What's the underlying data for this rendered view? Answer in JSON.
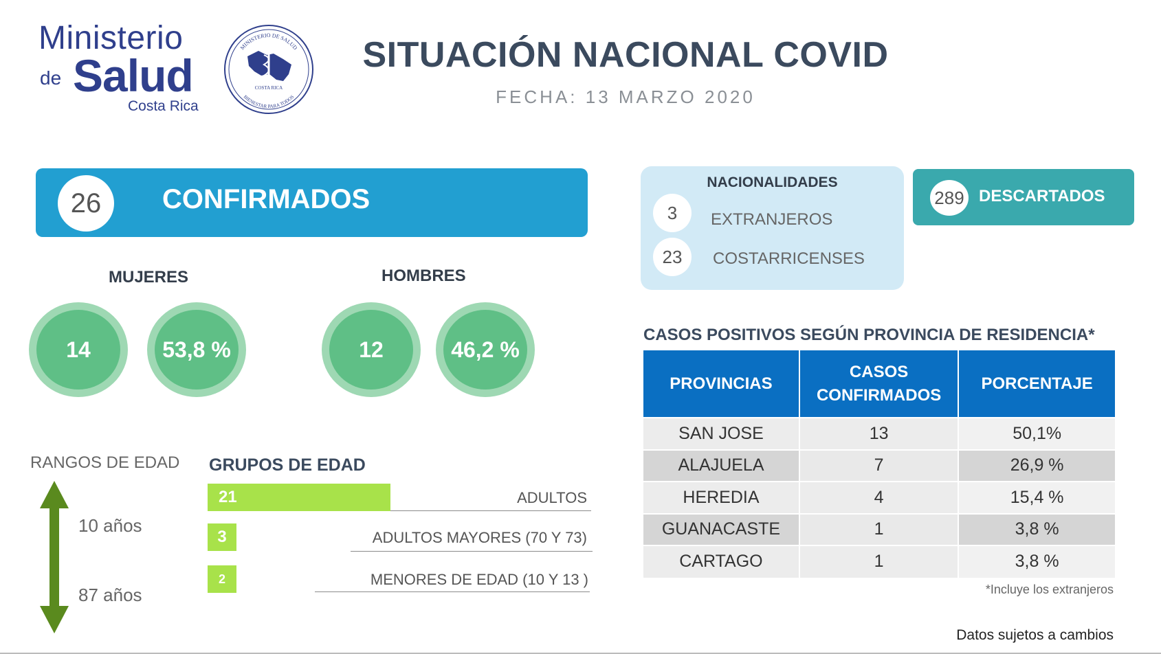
{
  "header": {
    "logo_line1": "Ministerio",
    "logo_de": "de",
    "logo_salud": "Salud",
    "logo_country": "Costa Rica",
    "seal_top_text": "MINISTERIO DE SALUD",
    "seal_bottom_text": "COSTA RICA",
    "seal_motto": "BIENESTAR PARA TODOS",
    "title": "SITUACIÓN NACIONAL COVID",
    "date": "FECHA: 13 MARZO 2020"
  },
  "confirmados": {
    "count": "26",
    "label": "CONFIRMADOS"
  },
  "gender": {
    "women": {
      "label": "MUJERES",
      "count": "14",
      "percent": "53,8 %"
    },
    "men": {
      "label": "HOMBRES",
      "count": "12",
      "percent": "46,2 %"
    }
  },
  "age": {
    "ranges_label": "RANGOS DE EDAD",
    "min": "10 años",
    "max": "87 años",
    "groups_label": "GRUPOS DE EDAD",
    "groups": [
      {
        "count": "21",
        "value": 21,
        "label": "ADULTOS"
      },
      {
        "count": "3",
        "value": 3,
        "label": "ADULTOS MAYORES (70 Y 73)"
      },
      {
        "count": "2",
        "value": 2,
        "label": "MENORES DE EDAD (10 Y 13 )"
      }
    ]
  },
  "nacionalidades": {
    "title": "NACIONALIDADES",
    "items": [
      {
        "count": "3",
        "label": "EXTRANJEROS"
      },
      {
        "count": "23",
        "label": "COSTARRICENSES"
      }
    ]
  },
  "descartados": {
    "count": "289",
    "label": "DESCARTADOS"
  },
  "provincias": {
    "title": "CASOS POSITIVOS SEGÚN PROVINCIA DE RESIDENCIA*",
    "headers": [
      "PROVINCIAS",
      "CASOS CONFIRMADOS",
      "PORCENTAJE"
    ],
    "rows": [
      [
        "SAN JOSE",
        "13",
        "50,1%"
      ],
      [
        "ALAJUELA",
        "7",
        "26,9 %"
      ],
      [
        "HEREDIA",
        "4",
        "15,4 %"
      ],
      [
        "GUANACASTE",
        "1",
        "3,8 %"
      ],
      [
        "CARTAGO",
        "1",
        "3,8 %"
      ]
    ],
    "footnote": "*Incluye los extranjeros"
  },
  "disclaimer": "Datos sujetos a cambios",
  "colors": {
    "confirm_blue": "#229fd1",
    "table_header_blue": "#0a6fc2",
    "gender_green": "#5fbf86",
    "bar_green": "#a8e24a",
    "arrow_green": "#5a8a1e",
    "descartados_teal": "#3aa9ad",
    "nacionalidades_bg": "#d2eaf6"
  }
}
